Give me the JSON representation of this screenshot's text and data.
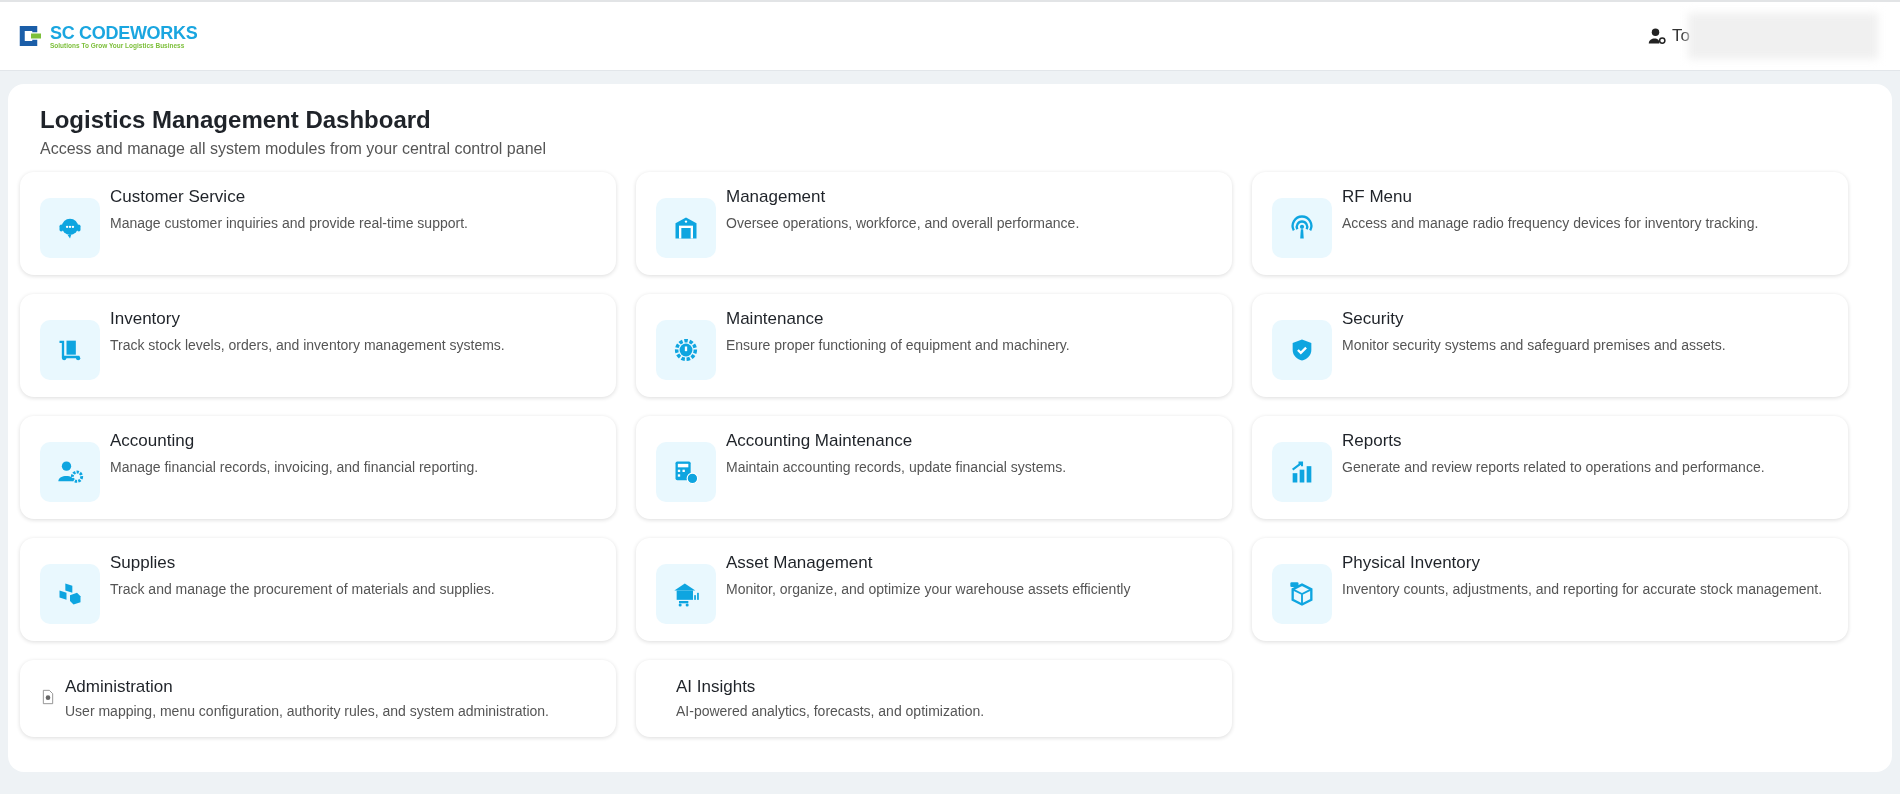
{
  "header": {
    "logo": {
      "name": "SC CODEWORKS",
      "tagline": "Solutions To Grow Your Logistics Business"
    },
    "user": {
      "name": "To"
    }
  },
  "dashboard": {
    "title": "Logistics Management Dashboard",
    "subtitle": "Access and manage all system modules from your central control panel",
    "modules": [
      {
        "kind": "tile",
        "title": "Customer Service",
        "description": "Manage customer inquiries and provide real-time support."
      },
      {
        "kind": "tile",
        "title": "Management",
        "description": "Oversee operations, workforce, and overall performance."
      },
      {
        "kind": "tile",
        "title": "RF Menu",
        "description": "Access and manage radio frequency devices for inventory tracking."
      },
      {
        "kind": "tile",
        "title": "Inventory",
        "description": "Track stock levels, orders, and inventory management systems."
      },
      {
        "kind": "tile",
        "title": "Maintenance",
        "description": "Ensure proper functioning of equipment and machinery."
      },
      {
        "kind": "tile",
        "title": "Security",
        "description": "Monitor security systems and safeguard premises and assets."
      },
      {
        "kind": "tile",
        "title": "Accounting",
        "description": "Manage financial records, invoicing, and financial reporting."
      },
      {
        "kind": "tile",
        "title": "Accounting Maintenance",
        "description": "Maintain accounting records, update financial systems."
      },
      {
        "kind": "tile",
        "title": "Reports",
        "description": "Generate and review reports related to operations and performance."
      },
      {
        "kind": "tile",
        "title": "Supplies",
        "description": "Track and manage the procurement of materials and supplies."
      },
      {
        "kind": "tile",
        "title": "Asset Management",
        "description": "Monitor, organize, and optimize your warehouse assets efficiently"
      },
      {
        "kind": "tile",
        "title": "Physical Inventory",
        "description": "Inventory counts, adjustments, and reporting for accurate stock management."
      },
      {
        "kind": "compact",
        "title": "Administration",
        "description": "User mapping, menu configuration, authority rules, and system administration."
      },
      {
        "kind": "compact",
        "title": "AI Insights",
        "description": "AI-powered analytics, forecasts, and optimization."
      }
    ]
  }
}
